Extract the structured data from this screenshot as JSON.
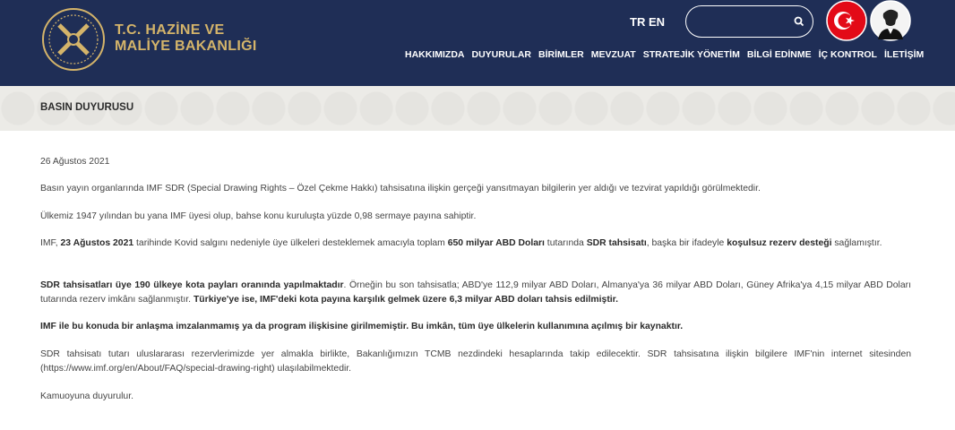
{
  "header": {
    "logo_line1": "T.C. HAZİNE VE",
    "logo_line2": "MALİYE BAKANLIĞI",
    "lang_tr": "TR",
    "lang_en": "EN",
    "search_placeholder": "",
    "search_value": "",
    "colors": {
      "bg": "#1f2e56",
      "gold": "#d4b46a",
      "flag_red": "#e30a17"
    },
    "nav": [
      "HAKKIMIZDA",
      "DUYURULAR",
      "BİRİMLER",
      "MEVZUAT",
      "STRATEJİK YÖNETİM",
      "BİLGİ EDİNME",
      "İÇ KONTROL",
      "İLETİŞİM"
    ]
  },
  "banner": {
    "title": "BASIN DUYURUSU"
  },
  "article": {
    "date": "26 Ağustos 2021",
    "p1": "Basın yayın organlarında IMF SDR (Special Drawing Rights – Özel Çekme Hakkı) tahsisatına ilişkin gerçeği yansıtmayan bilgilerin yer aldığı ve tezvirat yapıldığı görülmektedir.",
    "p2": "Ülkemiz 1947 yılından bu yana IMF üyesi olup, bahse konu kuruluşta yüzde 0,98 sermaye payına sahiptir.",
    "p3": {
      "a": "IMF, ",
      "b": "23 Ağustos 2021",
      "c": " tarihinde Kovid salgını nedeniyle üye ülkeleri desteklemek amacıyla toplam ",
      "d": "650 milyar ABD Doları",
      "e": " tutarında ",
      "f": "SDR tahsisatı",
      "g": ", başka bir ifadeyle ",
      "h": "koşulsuz rezerv desteği",
      "i": " sağlamıştır."
    },
    "p4": {
      "a": "SDR tahsisatları üye 190 ülkeye kota payları oranında yapılmaktadır",
      "b": ". Örneğin bu son tahsisatla; ABD'ye 112,9 milyar ABD Doları, Almanya'ya 36 milyar ABD Doları, Güney Afrika'ya 4,15 milyar ABD Doları tutarında rezerv imkânı sağlanmıştır. ",
      "c": "Türkiye'ye ise, IMF'deki kota payına karşılık gelmek üzere 6,3 milyar ABD doları tahsis edilmiştir."
    },
    "p5": "IMF ile bu konuda bir anlaşma imzalanmamış ya da program ilişkisine girilmemiştir. Bu imkân, tüm üye ülkelerin kullanımına açılmış bir kaynaktır.",
    "p6": "SDR tahsisatı tutarı uluslararası rezervlerimizde yer almakla birlikte, Bakanlığımızın TCMB nezdindeki hesaplarında takip edilecektir. SDR tahsisatına ilişkin bilgilere IMF'nin internet sitesinden (https://www.imf.org/en/About/FAQ/special-drawing-right) ulaşılabilmektedir.",
    "p7": "Kamuoyuna duyurulur."
  }
}
